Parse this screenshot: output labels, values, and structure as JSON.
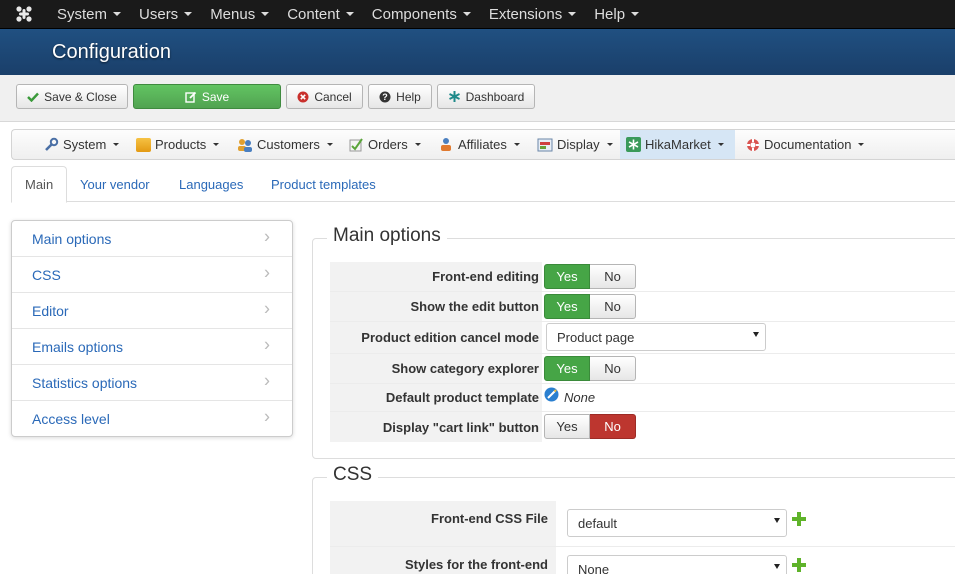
{
  "topnav": {
    "logo_icon": "joomla-icon",
    "menus": [
      "System",
      "Users",
      "Menus",
      "Content",
      "Components",
      "Extensions",
      "Help"
    ]
  },
  "header": {
    "title": "Configuration"
  },
  "toolbar": {
    "save_close": "Save & Close",
    "save": "Save",
    "cancel": "Cancel",
    "help": "Help",
    "dashboard": "Dashboard"
  },
  "hikamenu": {
    "items": [
      {
        "label": "System",
        "icon": "wrench-icon"
      },
      {
        "label": "Products",
        "icon": "box-icon"
      },
      {
        "label": "Customers",
        "icon": "users-icon"
      },
      {
        "label": "Orders",
        "icon": "orders-icon"
      },
      {
        "label": "Affiliates",
        "icon": "affiliates-icon"
      },
      {
        "label": "Display",
        "icon": "display-icon"
      },
      {
        "label": "HikaMarket",
        "icon": "hikamarket-icon"
      },
      {
        "label": "Documentation",
        "icon": "lifebuoy-icon"
      }
    ],
    "active": "HikaMarket"
  },
  "tabs": [
    "Main",
    "Your vendor",
    "Languages",
    "Product templates"
  ],
  "sidenav": [
    "Main options",
    "CSS",
    "Editor",
    "Emails options",
    "Statistics options",
    "Access level"
  ],
  "main_options": {
    "legend": "Main options",
    "yes": "Yes",
    "no": "No",
    "frontend_editing": {
      "label": "Front-end editing",
      "value": "Yes"
    },
    "show_edit_button": {
      "label": "Show the edit button",
      "value": "Yes"
    },
    "cancel_mode": {
      "label": "Product edition cancel mode",
      "value": "Product page"
    },
    "category_explorer": {
      "label": "Show category explorer",
      "value": "Yes"
    },
    "default_template": {
      "label": "Default product template",
      "value": "None"
    },
    "cart_link": {
      "label": "Display \"cart link\" button",
      "value": "No"
    }
  },
  "css": {
    "legend": "CSS",
    "frontend_css": {
      "label": "Front-end CSS File",
      "value": "default"
    },
    "styles_frontend": {
      "label": "Styles for the front-end",
      "value": "None"
    }
  },
  "colors": {
    "yes_active": "#46a546",
    "no_active": "#bd362f",
    "link": "#2a69b8",
    "header": "#205081"
  }
}
